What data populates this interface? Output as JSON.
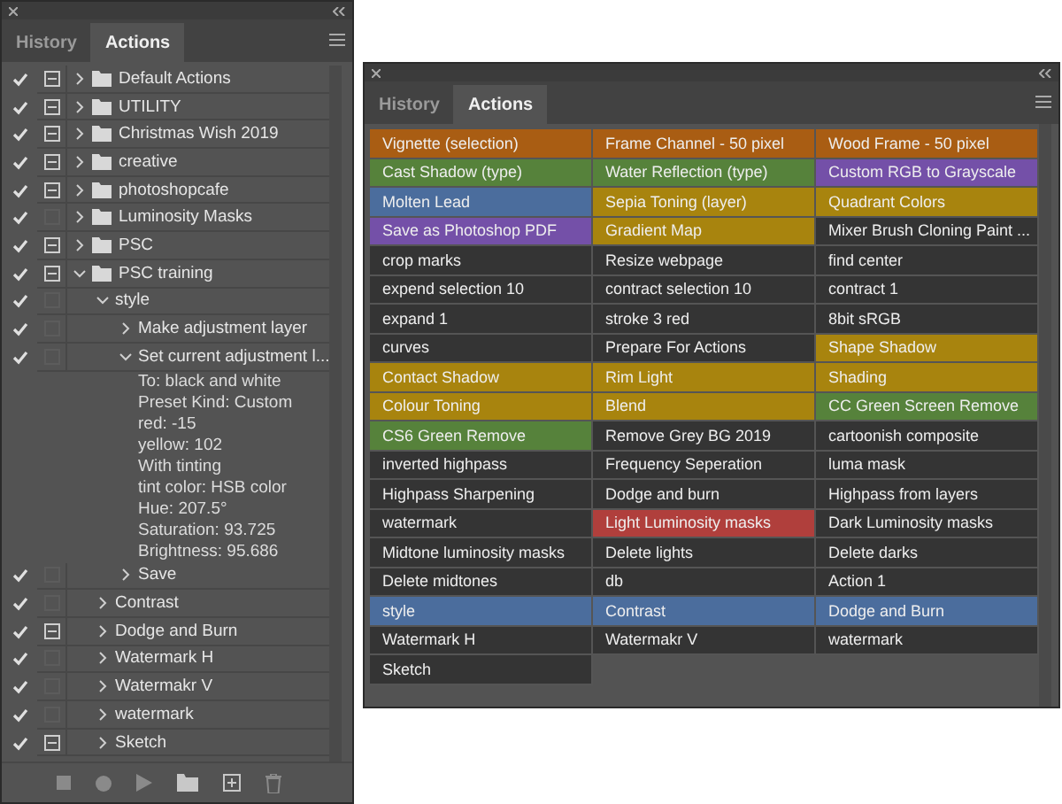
{
  "actions_panel": {
    "tabs": [
      {
        "label": "History",
        "selected": false
      },
      {
        "label": "Actions",
        "selected": true
      }
    ],
    "sets": [
      {
        "kind": "set",
        "name": "Default Actions",
        "enabled": true,
        "dialog": true,
        "expanded": false
      },
      {
        "kind": "set",
        "name": "UTILITY",
        "enabled": true,
        "dialog": true,
        "expanded": false
      },
      {
        "kind": "set",
        "name": "Christmas Wish 2019",
        "enabled": true,
        "dialog": true,
        "expanded": false
      },
      {
        "kind": "set",
        "name": "creative",
        "enabled": true,
        "dialog": true,
        "expanded": false
      },
      {
        "kind": "set",
        "name": "photoshopcafe",
        "enabled": true,
        "dialog": true,
        "expanded": false
      },
      {
        "kind": "set",
        "name": "Luminosity Masks",
        "enabled": true,
        "dialog": false,
        "expanded": false
      },
      {
        "kind": "set",
        "name": "PSC",
        "enabled": true,
        "dialog": true,
        "expanded": false
      },
      {
        "kind": "set",
        "name": "PSC training",
        "enabled": true,
        "dialog": true,
        "expanded": true,
        "children": [
          {
            "kind": "action",
            "name": "style",
            "enabled": true,
            "dialog": false,
            "expanded": true,
            "children": [
              {
                "kind": "step",
                "name": "Make adjustment layer",
                "enabled": true,
                "dialog": false,
                "expanded": false
              },
              {
                "kind": "step",
                "name": "Set current adjustment l...",
                "enabled": true,
                "dialog": false,
                "expanded": true,
                "details": [
                  "To: black and white",
                  "Preset Kind: Custom",
                  "red: -15",
                  "yellow: 102",
                  "With tinting",
                  "tint color: HSB color",
                  "Hue: 207.5°",
                  "Saturation: 93.725",
                  "Brightness: 95.686"
                ]
              },
              {
                "kind": "step",
                "name": "Save",
                "enabled": true,
                "dialog": false,
                "expanded": false
              }
            ]
          },
          {
            "kind": "action",
            "name": "Contrast",
            "enabled": true,
            "dialog": false,
            "expanded": false
          },
          {
            "kind": "action",
            "name": "Dodge and Burn",
            "enabled": true,
            "dialog": true,
            "expanded": false
          },
          {
            "kind": "action",
            "name": "Watermark H",
            "enabled": true,
            "dialog": false,
            "expanded": false
          },
          {
            "kind": "action",
            "name": "Watermakr V",
            "enabled": true,
            "dialog": false,
            "expanded": false
          },
          {
            "kind": "action",
            "name": "watermark",
            "enabled": true,
            "dialog": false,
            "expanded": false
          },
          {
            "kind": "action",
            "name": "Sketch",
            "enabled": true,
            "dialog": true,
            "expanded": false
          }
        ]
      }
    ]
  },
  "button_panel": {
    "tabs": [
      {
        "label": "History",
        "selected": false
      },
      {
        "label": "Actions",
        "selected": true
      }
    ],
    "buttons": [
      {
        "label": "Vignette (selection)",
        "color": "#a95d13"
      },
      {
        "label": "Frame Channel - 50 pixel",
        "color": "#a95d13"
      },
      {
        "label": "Wood Frame - 50 pixel",
        "color": "#a95d13"
      },
      {
        "label": "Cast Shadow (type)",
        "color": "#56823b"
      },
      {
        "label": "Water Reflection (type)",
        "color": "#56823b"
      },
      {
        "label": "Custom RGB to Grayscale",
        "color": "#7450a8"
      },
      {
        "label": "Molten Lead",
        "color": "#4b6d9d"
      },
      {
        "label": "Sepia Toning (layer)",
        "color": "#a8840e"
      },
      {
        "label": "Quadrant Colors",
        "color": "#a8840e"
      },
      {
        "label": "Save as Photoshop PDF",
        "color": "#7450a8"
      },
      {
        "label": "Gradient Map",
        "color": "#a8840e"
      },
      {
        "label": "Mixer Brush Cloning Paint ...",
        "color": "#343434"
      },
      {
        "label": "crop marks",
        "color": "#343434"
      },
      {
        "label": "Resize webpage",
        "color": "#343434"
      },
      {
        "label": "find center",
        "color": "#343434"
      },
      {
        "label": "expend selection 10",
        "color": "#343434"
      },
      {
        "label": "contract selection 10",
        "color": "#343434"
      },
      {
        "label": "contract 1",
        "color": "#343434"
      },
      {
        "label": "expand 1",
        "color": "#343434"
      },
      {
        "label": "stroke 3 red",
        "color": "#343434"
      },
      {
        "label": "8bit sRGB",
        "color": "#343434"
      },
      {
        "label": "curves",
        "color": "#343434"
      },
      {
        "label": "Prepare For Actions",
        "color": "#343434"
      },
      {
        "label": "Shape Shadow",
        "color": "#a8840e"
      },
      {
        "label": "Contact Shadow",
        "color": "#a8840e"
      },
      {
        "label": "Rim Light",
        "color": "#a8840e"
      },
      {
        "label": "Shading",
        "color": "#a8840e"
      },
      {
        "label": "Colour Toning",
        "color": "#a8840e"
      },
      {
        "label": "Blend",
        "color": "#a8840e"
      },
      {
        "label": "CC Green Screen Remove",
        "color": "#56823b"
      },
      {
        "label": "CS6 Green Remove",
        "color": "#56823b"
      },
      {
        "label": "Remove Grey BG 2019",
        "color": "#343434"
      },
      {
        "label": "cartoonish composite",
        "color": "#343434"
      },
      {
        "label": "inverted highpass",
        "color": "#343434"
      },
      {
        "label": "Frequency Seperation",
        "color": "#343434"
      },
      {
        "label": "luma mask",
        "color": "#343434"
      },
      {
        "label": "Highpass Sharpening",
        "color": "#343434"
      },
      {
        "label": "Dodge and burn",
        "color": "#343434"
      },
      {
        "label": "Highpass from layers",
        "color": "#343434"
      },
      {
        "label": "watermark",
        "color": "#343434"
      },
      {
        "label": "Light Luminosity masks",
        "color": "#b03f3c"
      },
      {
        "label": "Dark Luminosity masks",
        "color": "#343434"
      },
      {
        "label": "Midtone luminosity masks",
        "color": "#343434"
      },
      {
        "label": "Delete lights",
        "color": "#343434"
      },
      {
        "label": "Delete darks",
        "color": "#343434"
      },
      {
        "label": "Delete midtones",
        "color": "#343434"
      },
      {
        "label": "db",
        "color": "#343434"
      },
      {
        "label": "Action 1",
        "color": "#343434"
      },
      {
        "label": "style",
        "color": "#4b6d9d"
      },
      {
        "label": "Contrast",
        "color": "#4b6d9d"
      },
      {
        "label": "Dodge and Burn",
        "color": "#4b6d9d"
      },
      {
        "label": "Watermark H",
        "color": "#343434"
      },
      {
        "label": "Watermakr V",
        "color": "#343434"
      },
      {
        "label": "watermark",
        "color": "#343434"
      },
      {
        "label": "Sketch",
        "color": "#343434"
      }
    ]
  }
}
